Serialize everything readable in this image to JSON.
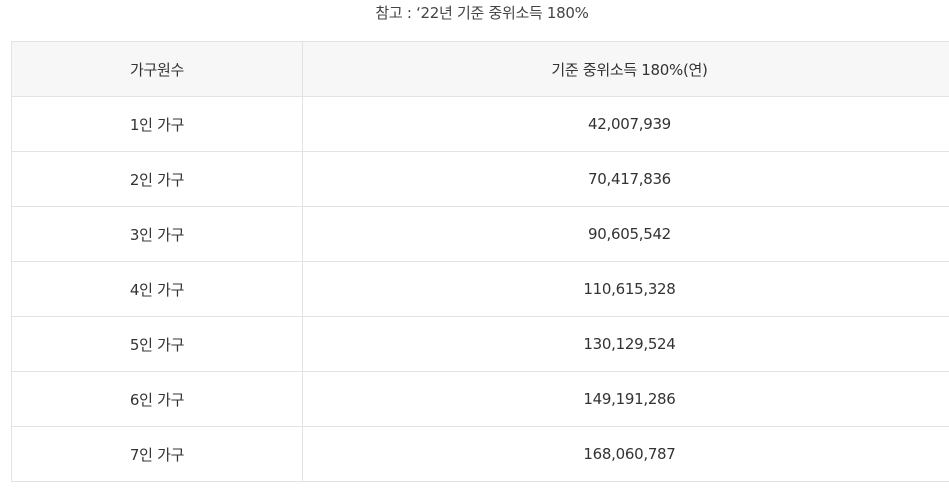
{
  "caption": "참고 : ‘22년 기준 중위소득 180%",
  "table": {
    "headers": [
      "가구원수",
      "기준 중위소득 180%(연)"
    ],
    "rows": [
      {
        "household": "1인 가구",
        "income": "42,007,939"
      },
      {
        "household": "2인 가구",
        "income": "70,417,836"
      },
      {
        "household": "3인 가구",
        "income": "90,605,542"
      },
      {
        "household": "4인 가구",
        "income": "110,615,328"
      },
      {
        "household": "5인 가구",
        "income": "130,129,524"
      },
      {
        "household": "6인 가구",
        "income": "149,191,286"
      },
      {
        "household": "7인 가구",
        "income": "168,060,787"
      }
    ]
  }
}
